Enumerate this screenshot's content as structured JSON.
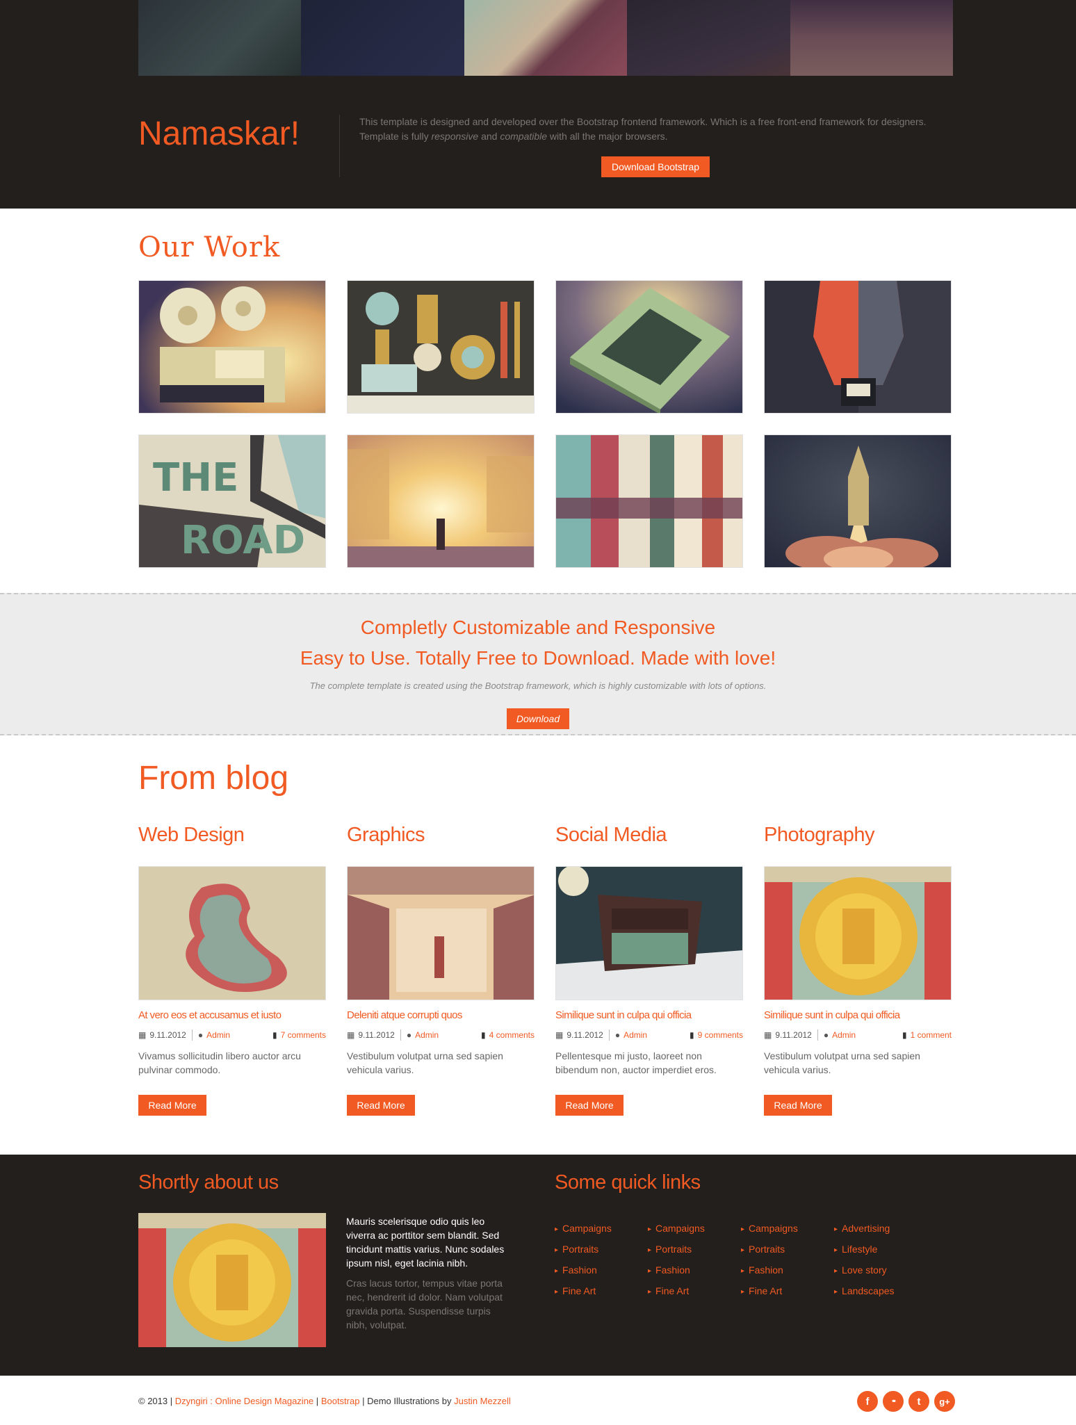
{
  "hero": {
    "title": "Namaskar!",
    "intro_1": "This template is designed and developed over the Bootstrap frontend framework. Which is a free front-end framework for designers.",
    "intro_2a": "Template is fully ",
    "intro_2b": "responsive",
    "intro_2c": " and ",
    "intro_2d": "compatible",
    "intro_2e": " with all the major browsers.",
    "button": "Download Bootstrap"
  },
  "work": {
    "title": "Our Work"
  },
  "promo": {
    "line1": "Completly Customizable and Responsive",
    "line2": "Easy to Use. Totally Free to Download. Made with love!",
    "sub": "The complete template is created using the Bootstrap framework, which is highly customizable with lots of options.",
    "button": "Download"
  },
  "blog": {
    "title": "From blog",
    "read_more": "Read More",
    "posts": [
      {
        "category": "Web Design",
        "title": "At vero eos et accusamus et iusto",
        "date": "9.11.2012",
        "author": "Admin",
        "comments": "7 comments",
        "excerpt": "Vivamus sollicitudin libero auctor arcu pulvinar commodo."
      },
      {
        "category": "Graphics",
        "title": "Deleniti atque corrupti quos",
        "date": "9.11.2012",
        "author": "Admin",
        "comments": "4 comments",
        "excerpt": "Vestibulum volutpat urna sed sapien vehicula varius."
      },
      {
        "category": "Social Media",
        "title": "Similique sunt in culpa qui officia",
        "date": "9.11.2012",
        "author": "Admin",
        "comments": "9 comments",
        "excerpt": "Pellentesque mi justo, laoreet non bibendum non, auctor imperdiet eros."
      },
      {
        "category": "Photography",
        "title": "Similique sunt in culpa qui officia",
        "date": "9.11.2012",
        "author": "Admin",
        "comments": "1 comment",
        "excerpt": "Vestibulum volutpat urna sed sapien vehicula varius."
      }
    ]
  },
  "footer": {
    "about_title": "Shortly about us",
    "about_text": "Mauris scelerisque odio quis leo viverra ac porttitor sem blandit. Sed tincidunt mattis varius. Nunc sodales ipsum nisl, eget lacinia nibh.",
    "about_text2": "Cras lacus tortor, tempus vitae porta nec, hendrerit id dolor. Nam volutpat gravida porta. Suspendisse turpis nibh, volutpat.",
    "links_title": "Some quick links",
    "links": [
      [
        "Campaigns",
        "Portraits",
        "Fashion",
        "Fine Art"
      ],
      [
        "Campaigns",
        "Portraits",
        "Fashion",
        "Fine Art"
      ],
      [
        "Campaigns",
        "Portraits",
        "Fashion",
        "Fine Art"
      ],
      [
        "Advertising",
        "Lifestyle",
        "Love story",
        "Landscapes"
      ]
    ]
  },
  "bottom": {
    "copyright": "© 2013 |",
    "site": "Dzyngiri : Online Design Magazine",
    "sep": "|",
    "bootstrap": "Bootstrap",
    "demo": "| Demo Illustrations by",
    "author": "Justin Mezzell",
    "social": [
      "f",
      "••",
      "t",
      "g+"
    ]
  },
  "colors": {
    "accent": "#f15a22",
    "dark": "#231f1d"
  }
}
